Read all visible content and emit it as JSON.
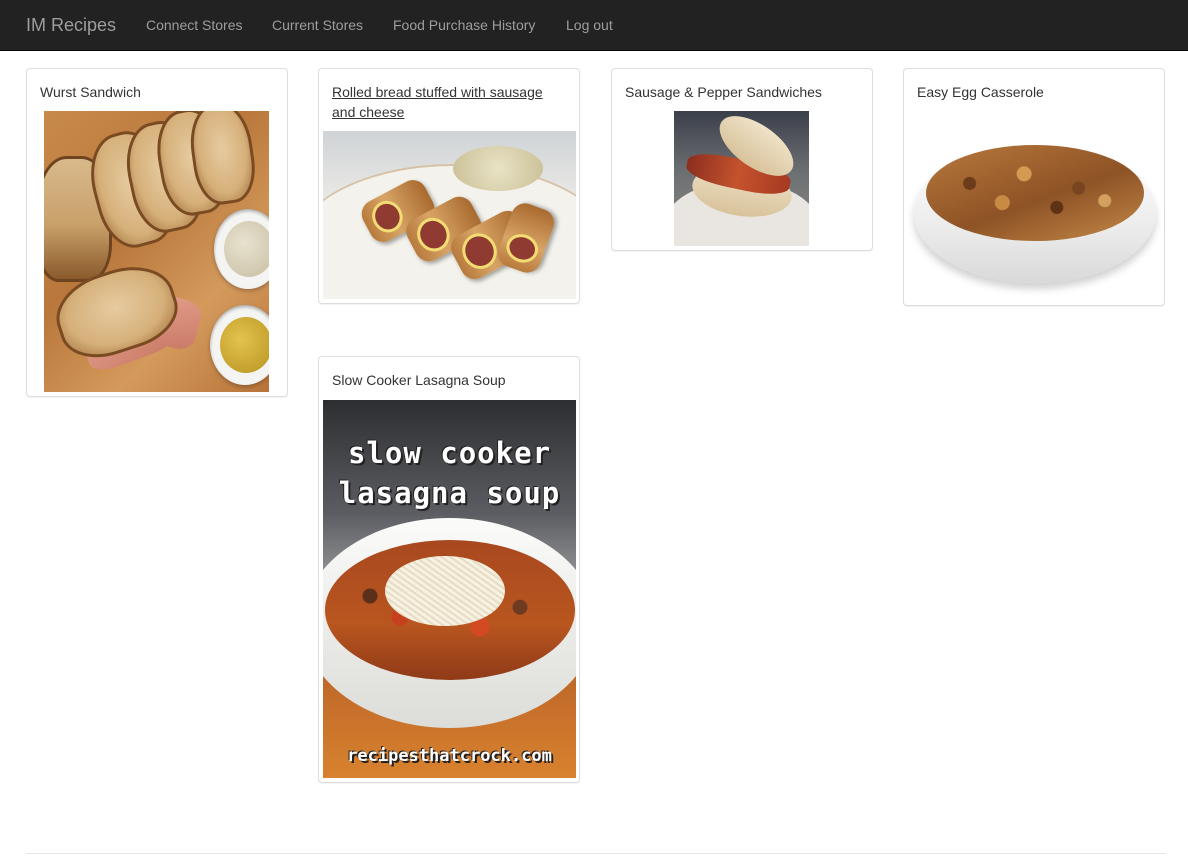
{
  "navbar": {
    "brand": "IM Recipes",
    "links": [
      "Connect Stores",
      "Current Stores",
      "Food Purchase History",
      "Log out"
    ]
  },
  "recipes": [
    {
      "title": "Wurst Sandwich"
    },
    {
      "title": "Rolled bread stuffed with sausage and cheese"
    },
    {
      "title": "Sausage & Pepper Sandwiches"
    },
    {
      "title": "Easy Egg Casserole"
    },
    {
      "title": "Slow Cooker Lasagna Soup",
      "image_text": [
        "slow cooker",
        "lasagna soup"
      ],
      "watermark": "recipesthatcrock.com"
    }
  ]
}
